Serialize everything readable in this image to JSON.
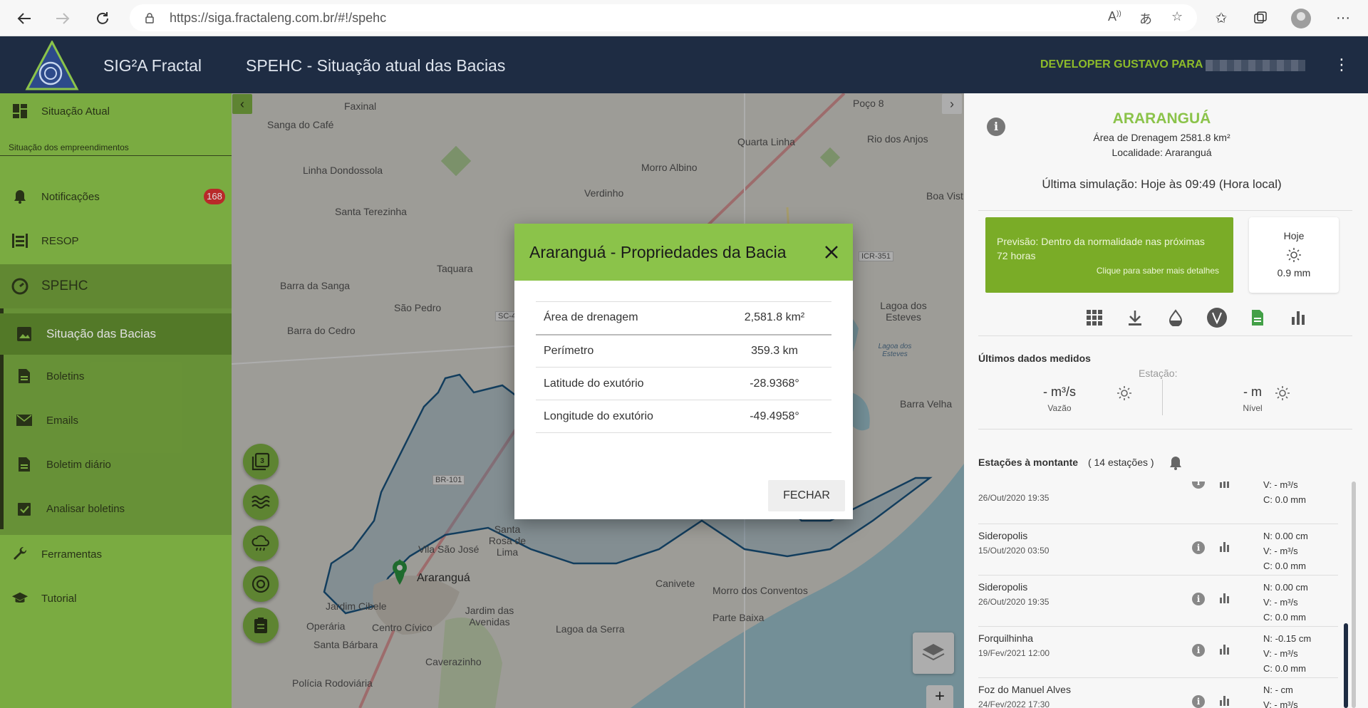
{
  "browser": {
    "url": "https://siga.fractaleng.com.br/#!/spehc"
  },
  "header": {
    "app_name": "SIG²A Fractal",
    "page_title": "SPEHC - Situação atual das Bacias",
    "user_label": "DEVELOPER GUSTAVO PARA"
  },
  "sidebar": {
    "situacao_atual": "Situação Atual",
    "sub_caption": "Situação dos empreendimentos",
    "notificacoes": "Notificações",
    "notificacoes_count": "168",
    "resop": "RESOP",
    "spehc": "SPEHC",
    "situacao_bacias": "Situação das Bacias",
    "boletins": "Boletins",
    "emails": "Emails",
    "boletim_diario": "Boletim diário",
    "analisar_boletins": "Analisar boletins",
    "ferramentas": "Ferramentas",
    "tutorial": "Tutorial"
  },
  "map": {
    "labels": [
      "Faxinal",
      "Sanga do Café",
      "Quarta Linha",
      "Poço 8",
      "Rio dos Anjos",
      "Morro Albino",
      "Linha Dondossola",
      "Verdinho",
      "Boa Vist",
      "Santa Terezinha",
      "ICR-351",
      "Taquara",
      "Barra da Sanga",
      "São Pedro",
      "SC-4",
      "Lagoa dos Esteves",
      "Barra do Cedro",
      "Lagoa dos Esteves",
      "Barra Velha",
      "BR-101",
      "Santa Rosa de Lima",
      "Vila São José",
      "Araranguá",
      "Canivete",
      "Jardim Cibele",
      "Jardim das Avenidas",
      "Morro dos Conventos",
      "Parte Baixa",
      "Operária",
      "Centro Cívico",
      "Lagoa da Serra",
      "Santa Bárbara",
      "Caverazinho",
      "Polícia Rodoviária"
    ]
  },
  "panel": {
    "basin_name": "ARARANGUÁ",
    "area": "Área de Drenagem 2581.8 km²",
    "locality": "Localidade: Araranguá",
    "last_sim": "Última simulação: Hoje às 09:49 (Hora local)",
    "forecast_text": "Previsão: Dentro da normalidade nas próximas 72 horas",
    "forecast_link": "Clique para saber mais detalhes",
    "today_label": "Hoje",
    "today_rain": "0.9 mm",
    "measured_title": "Últimos dados medidos",
    "station_label": "Estação:",
    "flow_value": "- m³/s",
    "flow_label": "Vazão",
    "level_value": "- m",
    "level_label": "Nível",
    "upstream_title": "Estações à montante",
    "upstream_count": "( 14 estações )",
    "stations": [
      {
        "name": "",
        "date": "26/Out/2020 19:35",
        "n": "",
        "v": "V: - m³/s",
        "c": "C: 0.0 mm"
      },
      {
        "name": "Sideropolis",
        "date": "15/Out/2020 03:50",
        "n": "N: 0.00 cm",
        "v": "V: - m³/s",
        "c": "C: 0.0 mm"
      },
      {
        "name": "Sideropolis",
        "date": "26/Out/2020 19:35",
        "n": "N: 0.00 cm",
        "v": "V: - m³/s",
        "c": "C: 0.0 mm"
      },
      {
        "name": "Forquilhinha",
        "date": "19/Fev/2021 12:00",
        "n": "N: -0.15 cm",
        "v": "V: - m³/s",
        "c": "C: 0.0 mm"
      },
      {
        "name": "Foz do Manuel Alves",
        "date": "24/Fev/2022 17:30",
        "n": "N: - cm",
        "v": "V: - m³/s",
        "c": ""
      }
    ]
  },
  "modal": {
    "title": "Araranguá - Propriedades da Bacia",
    "rows": [
      {
        "key": "Área de drenagem",
        "value": "2,581.8 km²"
      },
      {
        "key": "Perímetro",
        "value": "359.3 km"
      },
      {
        "key": "Latitude do exutório",
        "value": "-28.9368°"
      },
      {
        "key": "Longitude do exutório",
        "value": "-49.4958°"
      }
    ],
    "close_label": "FECHAR"
  }
}
